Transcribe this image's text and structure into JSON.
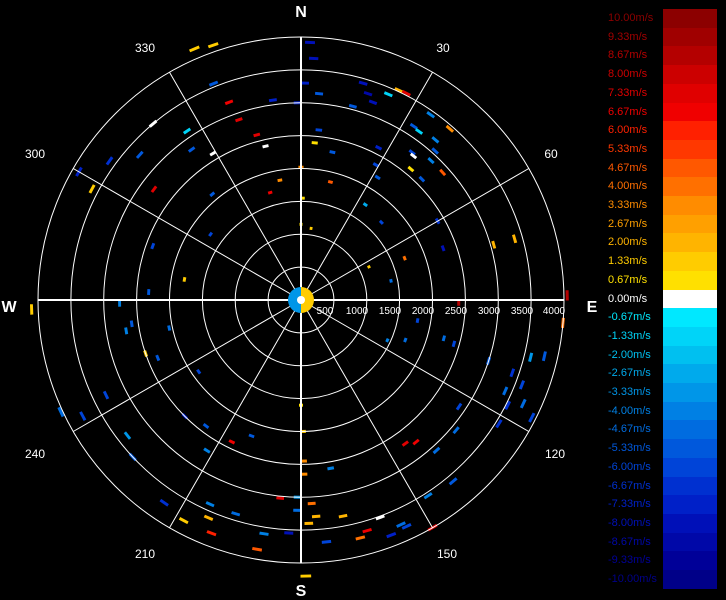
{
  "chart_data": {
    "type": "polar-sector",
    "compass": {
      "north": "N",
      "south": "S",
      "east": "E",
      "west": "W"
    },
    "azimuth_labels": [
      {
        "angle": 30,
        "text": "30"
      },
      {
        "angle": 60,
        "text": "60"
      },
      {
        "angle": 120,
        "text": "120"
      },
      {
        "angle": 150,
        "text": "150"
      },
      {
        "angle": 210,
        "text": "210"
      },
      {
        "angle": 240,
        "text": "240"
      },
      {
        "angle": 300,
        "text": "300"
      },
      {
        "angle": 330,
        "text": "330"
      }
    ],
    "range_rings": [
      500,
      1000,
      1500,
      2000,
      2500,
      3000,
      3500,
      4000
    ],
    "range_labels": [
      "500",
      "1000",
      "1500",
      "2000",
      "2500",
      "3000",
      "3500",
      "4000"
    ],
    "rmax": 4000,
    "legend": {
      "unit": "m/s",
      "entries": [
        {
          "label": "10.00m/s",
          "color": "#8c0000"
        },
        {
          "label": "9.33m/s",
          "color": "#a00000"
        },
        {
          "label": "8.67m/s",
          "color": "#b40000"
        },
        {
          "label": "8.00m/s",
          "color": "#cc0000"
        },
        {
          "label": "7.33m/s",
          "color": "#e00000"
        },
        {
          "label": "6.67m/s",
          "color": "#f00000"
        },
        {
          "label": "6.00m/s",
          "color": "#ff2000"
        },
        {
          "label": "5.33m/s",
          "color": "#ff3800"
        },
        {
          "label": "4.67m/s",
          "color": "#ff5800"
        },
        {
          "label": "4.00m/s",
          "color": "#ff7000"
        },
        {
          "label": "3.33m/s",
          "color": "#ff8c00"
        },
        {
          "label": "2.67m/s",
          "color": "#ffa000"
        },
        {
          "label": "2.00m/s",
          "color": "#ffb400"
        },
        {
          "label": "1.33m/s",
          "color": "#ffcc00"
        },
        {
          "label": "0.67m/s",
          "color": "#ffe000"
        },
        {
          "label": "0.00m/s",
          "color": "#ffffff"
        },
        {
          "label": "-0.67m/s",
          "color": "#00e8ff"
        },
        {
          "label": "-1.33m/s",
          "color": "#00d4f8"
        },
        {
          "label": "-2.00m/s",
          "color": "#00c0f0"
        },
        {
          "label": "-2.67m/s",
          "color": "#00aaec"
        },
        {
          "label": "-3.33m/s",
          "color": "#0096e8"
        },
        {
          "label": "-4.00m/s",
          "color": "#0080e4"
        },
        {
          "label": "-4.67m/s",
          "color": "#006ce0"
        },
        {
          "label": "-5.33m/s",
          "color": "#0058dc"
        },
        {
          "label": "-6.00m/s",
          "color": "#0044d8"
        },
        {
          "label": "-6.67m/s",
          "color": "#0030d0"
        },
        {
          "label": "-7.33m/s",
          "color": "#0020c8"
        },
        {
          "label": "-8.00m/s",
          "color": "#0010b8"
        },
        {
          "label": "-8.67m/s",
          "color": "#0008a8"
        },
        {
          "label": "-9.33m/s",
          "color": "#000098"
        },
        {
          "label": "-10.00m/s",
          "color": "#000088"
        }
      ]
    },
    "cells": [
      {
        "az": 2,
        "r": 3920,
        "v": -8
      },
      {
        "az": 3,
        "r": 3680,
        "v": -8
      },
      {
        "az": 1,
        "r": 3300,
        "v": -7.3
      },
      {
        "az": 359,
        "r": 3000,
        "v": -7
      },
      {
        "az": 0,
        "r": 2020,
        "v": 3.3
      },
      {
        "az": 1,
        "r": 1550,
        "v": 0.7
      },
      {
        "az": 0,
        "r": 1150,
        "v": 0.7
      },
      {
        "az": 5,
        "r": 2400,
        "v": 0.7
      },
      {
        "az": 8,
        "r": 1100,
        "v": 1.3
      },
      {
        "az": 16,
        "r": 3430,
        "v": -8
      },
      {
        "az": 18,
        "r": 3300,
        "v": -8.7
      },
      {
        "az": 20,
        "r": 3200,
        "v": -8
      },
      {
        "az": 23,
        "r": 3400,
        "v": -1.3
      },
      {
        "az": 25,
        "r": 3520,
        "v": 2
      },
      {
        "az": 27,
        "r": 3530,
        "v": 7.3
      },
      {
        "az": 33,
        "r": 3150,
        "v": -5.3
      },
      {
        "az": 35,
        "r": 3440,
        "v": -4
      },
      {
        "az": 35,
        "r": 3130,
        "v": -1.3
      },
      {
        "az": 37,
        "r": 2810,
        "v": -6
      },
      {
        "az": 38,
        "r": 2780,
        "v": 0
      },
      {
        "az": 40,
        "r": 3180,
        "v": -4
      },
      {
        "az": 41,
        "r": 3450,
        "v": 3.3
      },
      {
        "az": 42,
        "r": 3050,
        "v": -5.3
      },
      {
        "az": 43,
        "r": 2900,
        "v": -4
      },
      {
        "az": 45,
        "r": 2600,
        "v": -5.3
      },
      {
        "az": 48,
        "r": 2900,
        "v": 4.7
      },
      {
        "az": 29,
        "r": 2350,
        "v": -6
      },
      {
        "az": 32,
        "r": 2200,
        "v": -5.3
      },
      {
        "az": 27,
        "r": 2600,
        "v": -7.3
      },
      {
        "az": 34,
        "r": 1750,
        "v": -2.7
      },
      {
        "az": 46,
        "r": 1700,
        "v": -6
      },
      {
        "az": 60,
        "r": 2400,
        "v": -6.7
      },
      {
        "az": 70,
        "r": 2300,
        "v": -8
      },
      {
        "az": 68,
        "r": 1700,
        "v": 4
      },
      {
        "az": 74,
        "r": 3050,
        "v": 2
      },
      {
        "az": 74,
        "r": 3380,
        "v": 2
      },
      {
        "az": 78,
        "r": 1400,
        "v": -4.7
      },
      {
        "az": 64,
        "r": 1150,
        "v": 1.3
      },
      {
        "az": 89,
        "r": 4050,
        "v": 9
      },
      {
        "az": 91,
        "r": 2400,
        "v": 9
      },
      {
        "az": 95,
        "r": 4000,
        "v": 4
      },
      {
        "az": 100,
        "r": 1800,
        "v": -6
      },
      {
        "az": 103,
        "r": 3800,
        "v": -5.3
      },
      {
        "az": 104,
        "r": 3600,
        "v": -3.3
      },
      {
        "az": 105,
        "r": 2250,
        "v": -4.7
      },
      {
        "az": 106,
        "r": 2420,
        "v": -6
      },
      {
        "az": 108,
        "r": 3000,
        "v": -5.3
      },
      {
        "az": 109,
        "r": 3400,
        "v": -6.7
      },
      {
        "az": 111,
        "r": 3600,
        "v": -6
      },
      {
        "az": 114,
        "r": 3400,
        "v": -4.7
      },
      {
        "az": 115,
        "r": 3730,
        "v": -4.7
      },
      {
        "az": 117,
        "r": 3940,
        "v": -6
      },
      {
        "az": 117,
        "r": 3530,
        "v": -6.7
      },
      {
        "az": 111,
        "r": 1700,
        "v": -4.7
      },
      {
        "az": 115,
        "r": 1450,
        "v": -4
      },
      {
        "az": 122,
        "r": 3550,
        "v": -6.7
      },
      {
        "az": 124,
        "r": 2900,
        "v": -6
      },
      {
        "az": 130,
        "r": 3080,
        "v": -4.7
      },
      {
        "az": 138,
        "r": 3080,
        "v": -4.7
      },
      {
        "az": 141,
        "r": 2780,
        "v": 6.7
      },
      {
        "az": 144,
        "r": 2700,
        "v": 7.3
      },
      {
        "az": 140,
        "r": 3600,
        "v": -5.3
      },
      {
        "az": 147,
        "r": 3550,
        "v": -4
      },
      {
        "az": 150,
        "r": 4000,
        "v": 7.3
      },
      {
        "az": 155,
        "r": 3800,
        "v": -6
      },
      {
        "az": 156,
        "r": 3740,
        "v": -4.7
      },
      {
        "az": 159,
        "r": 3830,
        "v": -7.3
      },
      {
        "az": 160,
        "r": 3520,
        "v": 0
      },
      {
        "az": 164,
        "r": 3650,
        "v": 6.7
      },
      {
        "az": 166,
        "r": 3730,
        "v": 4
      },
      {
        "az": 169,
        "r": 3350,
        "v": 2
      },
      {
        "az": 174,
        "r": 3700,
        "v": -6
      },
      {
        "az": 176,
        "r": 3300,
        "v": 2
      },
      {
        "az": 177,
        "r": 3100,
        "v": 4
      },
      {
        "az": 178,
        "r": 3400,
        "v": 2
      },
      {
        "az": 179,
        "r": 2650,
        "v": 3.3
      },
      {
        "az": 179,
        "r": 2450,
        "v": 3.3
      },
      {
        "az": 179,
        "r": 2000,
        "v": 1.3
      },
      {
        "az": 180,
        "r": 1600,
        "v": 0.7
      },
      {
        "az": 179,
        "r": 4200,
        "v": 1.3
      },
      {
        "az": 181,
        "r": 3000,
        "v": -3.3
      },
      {
        "az": 181,
        "r": 3200,
        "v": -4.7
      },
      {
        "az": 183,
        "r": 3550,
        "v": -8
      },
      {
        "az": 186,
        "r": 3030,
        "v": 7.3
      },
      {
        "az": 189,
        "r": 3600,
        "v": -4
      },
      {
        "az": 190,
        "r": 3850,
        "v": 4.7
      },
      {
        "az": 197,
        "r": 3400,
        "v": -4.7
      },
      {
        "az": 201,
        "r": 3800,
        "v": 6
      },
      {
        "az": 203,
        "r": 3600,
        "v": 2
      },
      {
        "az": 204,
        "r": 3400,
        "v": -4
      },
      {
        "az": 208,
        "r": 3800,
        "v": 1.3
      },
      {
        "az": 214,
        "r": 3720,
        "v": -6.7
      },
      {
        "az": 212,
        "r": 2700,
        "v": -4
      },
      {
        "az": 206,
        "r": 2400,
        "v": 6.7
      },
      {
        "az": 217,
        "r": 2400,
        "v": -5.3
      },
      {
        "az": 225,
        "r": 2500,
        "v": -7.3
      },
      {
        "az": 227,
        "r": 3500,
        "v": -5.3
      },
      {
        "az": 232,
        "r": 3350,
        "v": -3.3
      },
      {
        "az": 242,
        "r": 3760,
        "v": -6
      },
      {
        "az": 245,
        "r": 4030,
        "v": -4.7
      },
      {
        "az": 244,
        "r": 3300,
        "v": -6
      },
      {
        "az": 248,
        "r": 2350,
        "v": -5.3
      },
      {
        "az": 251,
        "r": 2500,
        "v": 1.3
      },
      {
        "az": 260,
        "r": 2700,
        "v": -4
      },
      {
        "az": 258,
        "r": 2050,
        "v": -4.7
      },
      {
        "az": 262,
        "r": 2600,
        "v": -5.3
      },
      {
        "az": 268,
        "r": 4100,
        "v": 1.3
      },
      {
        "az": 273,
        "r": 2320,
        "v": -5.3
      },
      {
        "az": 269,
        "r": 2760,
        "v": -4
      },
      {
        "az": 290,
        "r": 2400,
        "v": -6
      },
      {
        "az": 298,
        "r": 3600,
        "v": 1.3
      },
      {
        "az": 300,
        "r": 3900,
        "v": -7.3
      },
      {
        "az": 306,
        "r": 3600,
        "v": -6.7
      },
      {
        "az": 307,
        "r": 2800,
        "v": 7.3
      },
      {
        "az": 306,
        "r": 1700,
        "v": -6
      },
      {
        "az": 312,
        "r": 3300,
        "v": -5.3
      },
      {
        "az": 320,
        "r": 3500,
        "v": -0.2
      },
      {
        "az": 324,
        "r": 2830,
        "v": -5.3
      },
      {
        "az": 326,
        "r": 3100,
        "v": -1.3
      },
      {
        "az": 329,
        "r": 2600,
        "v": -0.2
      },
      {
        "az": 338,
        "r": 3550,
        "v": -5.3
      },
      {
        "az": 340,
        "r": 3200,
        "v": 6.7
      },
      {
        "az": 341,
        "r": 2900,
        "v": 7.3
      },
      {
        "az": 345,
        "r": 2600,
        "v": 7.3
      },
      {
        "az": 347,
        "r": 2400,
        "v": 0
      },
      {
        "az": 350,
        "r": 1850,
        "v": 3.3
      },
      {
        "az": 344,
        "r": 1700,
        "v": 6.7
      },
      {
        "az": 337,
        "r": 4150,
        "v": 1.3
      },
      {
        "az": 341,
        "r": 4100,
        "v": 1.3
      },
      {
        "az": 352,
        "r": 3070,
        "v": -7.3
      },
      {
        "az": 5,
        "r": 3150,
        "v": -5.3
      },
      {
        "az": 6,
        "r": 2600,
        "v": -6
      },
      {
        "az": 12,
        "r": 2300,
        "v": -5.3
      },
      {
        "az": 14,
        "r": 1850,
        "v": 4.7
      },
      {
        "az": 15,
        "r": 3050,
        "v": -5.3
      },
      {
        "az": 40,
        "r": 2600,
        "v": 0.7
      },
      {
        "az": 170,
        "r": 2600,
        "v": -4
      },
      {
        "az": 200,
        "r": 2200,
        "v": -5.3
      },
      {
        "az": 235,
        "r": 1900,
        "v": -6
      },
      {
        "az": 280,
        "r": 1800,
        "v": 1.3
      },
      {
        "az": 320,
        "r": 2100,
        "v": -5.3
      }
    ]
  }
}
